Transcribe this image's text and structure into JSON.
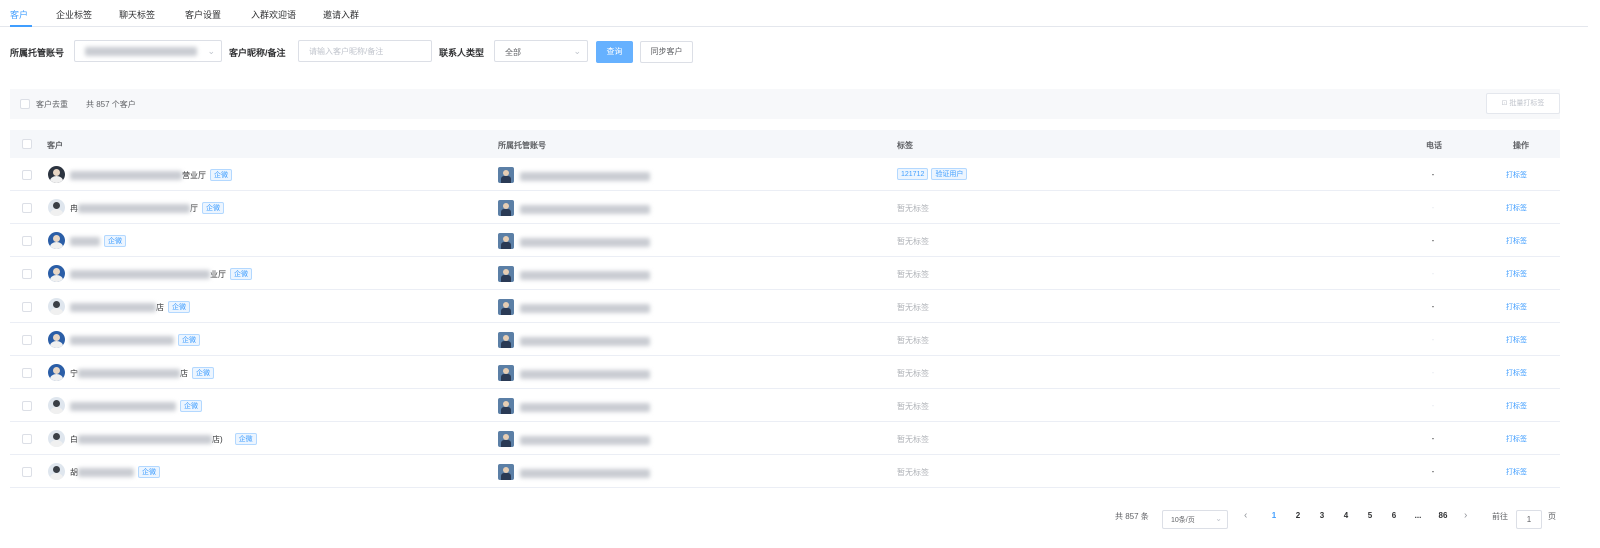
{
  "tabs": [
    {
      "label": "客户",
      "active": true
    },
    {
      "label": "企业标签",
      "active": false
    },
    {
      "label": "聊天标签",
      "active": false
    },
    {
      "label": "客户设置",
      "active": false
    },
    {
      "label": "入群欢迎语",
      "active": false
    },
    {
      "label": "邀请入群",
      "active": false
    }
  ],
  "filters": {
    "account_label": "所属托管账号",
    "customer_label": "客户昵称/备注",
    "customer_placeholder": "请输入客户昵称/备注",
    "contact_type_label": "联系人类型",
    "contact_type_value": "全部",
    "query_button": "查询",
    "sync_button": "同步客户"
  },
  "summary": {
    "dedupe_label": "客户去重",
    "count_text": "共 857 个客户",
    "batch_button": "批量打标签"
  },
  "table": {
    "columns": [
      "客户",
      "所属托管账号",
      "标签",
      "电话",
      "操作"
    ],
    "rows": [
      {
        "name_prefix": "",
        "name_suffix": "营业厅",
        "badge": "企微",
        "tags": [
          "121712",
          "验证用户"
        ],
        "no_tag": "",
        "phone": "-",
        "action": "打标签"
      },
      {
        "name_prefix": "冉",
        "name_suffix": "厅",
        "badge": "企微",
        "tags": [],
        "no_tag": "暂无标签",
        "phone": "-",
        "action": "打标签"
      },
      {
        "name_prefix": "",
        "name_suffix": "",
        "badge": "企微",
        "tags": [],
        "no_tag": "暂无标签",
        "phone": "-",
        "action": "打标签"
      },
      {
        "name_prefix": "",
        "name_suffix": "业厅",
        "badge": "企微",
        "tags": [],
        "no_tag": "暂无标签",
        "phone": "-",
        "action": "打标签"
      },
      {
        "name_prefix": "",
        "name_suffix": "店",
        "badge": "企微",
        "tags": [],
        "no_tag": "暂无标签",
        "phone": "-",
        "action": "打标签"
      },
      {
        "name_prefix": "",
        "name_suffix": "",
        "badge": "企微",
        "tags": [],
        "no_tag": "暂无标签",
        "phone": "-",
        "action": "打标签"
      },
      {
        "name_prefix": "宁",
        "name_suffix": "店",
        "badge": "企微",
        "tags": [],
        "no_tag": "暂无标签",
        "phone": "-",
        "action": "打标签"
      },
      {
        "name_prefix": "",
        "name_suffix": "",
        "badge": "企微",
        "tags": [],
        "no_tag": "暂无标签",
        "phone": "-",
        "action": "打标签"
      },
      {
        "name_prefix": "白",
        "name_suffix": "店)",
        "badge": "企微",
        "tags": [],
        "no_tag": "暂无标签",
        "phone": "-",
        "action": "打标签"
      },
      {
        "name_prefix": "胡",
        "name_suffix": "",
        "badge": "企微",
        "tags": [],
        "no_tag": "暂无标签",
        "phone": "-",
        "action": "打标签"
      }
    ]
  },
  "pagination": {
    "total_text": "共 857 条",
    "page_size": "10条/页",
    "pages": [
      "1",
      "2",
      "3",
      "4",
      "5",
      "6",
      "...",
      "86"
    ],
    "current": "1",
    "goto_label": "前往",
    "goto_value": "1",
    "page_unit": "页"
  },
  "colors": {
    "accent": "#409eff",
    "primary_button": "#66b1ff"
  }
}
